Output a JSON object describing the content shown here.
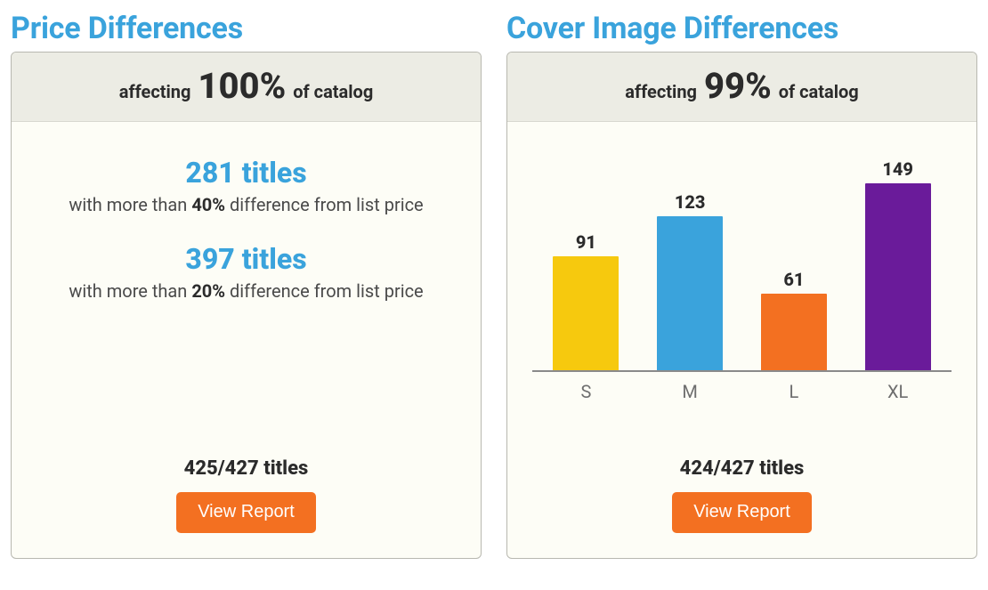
{
  "price_card": {
    "title": "Price Differences",
    "header_pre": "affecting",
    "header_pct": "100%",
    "header_post": "of catalog",
    "stats": [
      {
        "headline": "281 titles",
        "pre": "with more than",
        "bold": "40%",
        "post": "difference from list price"
      },
      {
        "headline": "397 titles",
        "pre": "with more than",
        "bold": "20%",
        "post": "difference from list price"
      }
    ],
    "totals": "425/427 titles",
    "button": "View Report"
  },
  "cover_card": {
    "title": "Cover Image Differences",
    "header_pre": "affecting",
    "header_pct": "99%",
    "header_post": "of catalog",
    "totals": "424/427 titles",
    "button": "View Report"
  },
  "chart_data": {
    "type": "bar",
    "categories": [
      "S",
      "M",
      "L",
      "XL"
    ],
    "values": [
      91,
      123,
      61,
      149
    ],
    "colors": [
      "#f6c90e",
      "#3aa3dc",
      "#f37021",
      "#6a1b9a"
    ],
    "ylim": [
      0,
      160
    ],
    "title": "",
    "xlabel": "",
    "ylabel": ""
  }
}
